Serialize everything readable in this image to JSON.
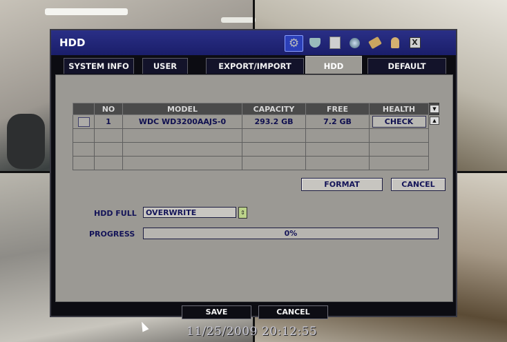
{
  "window": {
    "title": "HDD",
    "toolbar_icons": [
      "gear-icon",
      "camera-icon",
      "disk-icon",
      "network-icon",
      "tools-icon",
      "user-icon",
      "close-icon"
    ],
    "close_glyph": "X"
  },
  "tabs": [
    {
      "label": "SYSTEM INFO",
      "active": false
    },
    {
      "label": "USER",
      "active": false
    },
    {
      "label": "EXPORT/IMPORT",
      "active": false
    },
    {
      "label": "HDD",
      "active": true
    },
    {
      "label": "DEFAULT",
      "active": false
    }
  ],
  "table": {
    "headers": [
      "",
      "NO",
      "MODEL",
      "CAPACITY",
      "FREE",
      "HEALTH"
    ],
    "rows": [
      {
        "no": "1",
        "model": "WDC WD3200AAJS-0",
        "capacity": "293.2 GB",
        "free": "7.2 GB",
        "health": "CHECK"
      }
    ]
  },
  "actions": {
    "format": "FORMAT",
    "cancel": "CANCEL"
  },
  "hdd_full": {
    "label": "HDD FULL",
    "value": "OVERWRITE"
  },
  "progress": {
    "label": "PROGRESS",
    "value_text": "0%",
    "value": 0
  },
  "footer": {
    "save": "SAVE",
    "cancel": "CANCEL"
  },
  "status": {
    "timestamp": "11/25/2009 20:12:55"
  },
  "colors": {
    "titlebar": "#1f2478",
    "panel": "#9b9994",
    "accent_text": "#141458"
  }
}
